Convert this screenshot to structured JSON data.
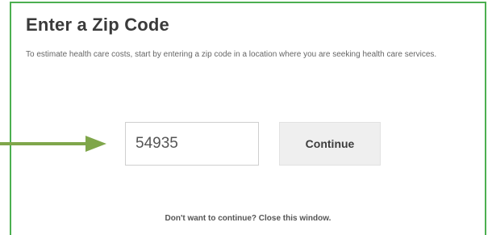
{
  "dialog": {
    "title": "Enter a Zip Code",
    "description": "To estimate health care costs, start by entering a zip code in a location where you are seeking health care services.",
    "zip_input": {
      "value": "54935",
      "placeholder": ""
    },
    "continue_label": "Continue",
    "close_text": "Don't want to continue? Close this window."
  },
  "annotation": {
    "arrow_color": "#7fa64a",
    "border_color": "#4caf50"
  }
}
